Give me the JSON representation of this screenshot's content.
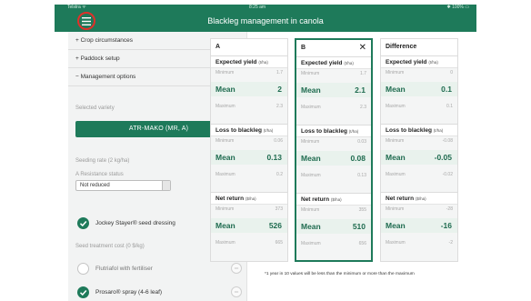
{
  "status": {
    "carrier": "Telstra ᯤ",
    "time": "8:25 am",
    "battery": "✱ 100% ▭"
  },
  "nav": {
    "title": "Blackleg management in canola"
  },
  "sidebar": {
    "crop": "+ Crop circumstances",
    "paddock": "+ Paddock setup",
    "management": "− Management options",
    "selected_variety_label": "Selected variety",
    "variety": "ATR-MAKO (MR, A)",
    "seeding_rate": "Seeding rate (2 kg/ha)",
    "resistance_label": "A Resistance status",
    "resistance_value": "Not reduced",
    "seed_dressing": "Jockey Stayer® seed dressing",
    "seed_cost": "Seed treatment cost (0 $/kg)",
    "fertiliser": "Flutriafol with fertiliser",
    "prosaro": "Prosaro® spray (4-6 leaf)"
  },
  "cards": [
    {
      "title": "A",
      "yield": [
        "1.7",
        "2",
        "2.3"
      ],
      "loss": [
        "0.06",
        "0.13",
        "0.2"
      ],
      "net": [
        "373",
        "526",
        "665"
      ]
    },
    {
      "title": "B",
      "close": "✕",
      "yield": [
        "1.7",
        "2.1",
        "2.3"
      ],
      "loss": [
        "0.03",
        "0.08",
        "0.13"
      ],
      "net": [
        "355",
        "510",
        "656"
      ]
    },
    {
      "title": "Difference",
      "yield": [
        "0",
        "0.1",
        "0.1"
      ],
      "loss": [
        "-0.08",
        "-0.05",
        "-0.02"
      ],
      "net": [
        "-28",
        "-16",
        "-2"
      ]
    }
  ],
  "sections": {
    "yield": "Expected yield",
    "yield_unit": "(t/ha)",
    "loss": "Loss to blackleg",
    "loss_unit": "(t/ha)",
    "net": "Net return",
    "net_unit": "($/ha)"
  },
  "row_labels": {
    "min": "Minimum",
    "mean": "Mean",
    "max": "Maximum"
  },
  "footnote": "*1 year in 10 values will be less than the minimum or more than the maximum",
  "colors": {
    "brand": "#1e7a5a",
    "highlight": "#e0302a"
  }
}
